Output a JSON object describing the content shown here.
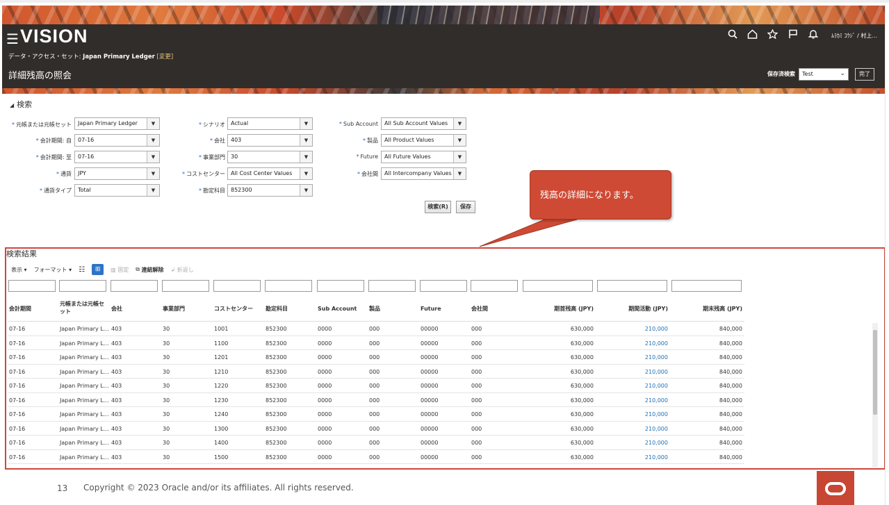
{
  "header": {
    "logo": "VISION",
    "data_access_label": "データ・アクセス・セット: ",
    "data_access_value": "Japan Primary Ledger",
    "data_access_link": "[変更]",
    "page_title": "詳細残高の照会",
    "user": "ﾑﾗｶﾐ ｺｳｼﾞ / 村上…",
    "saved_search_label": "保存済検索",
    "saved_search_value": "Test",
    "done_button": "完了",
    "icons": [
      "search-icon",
      "home-icon",
      "star-icon",
      "flag-icon",
      "bell-icon"
    ]
  },
  "search": {
    "title": "検索",
    "fields": [
      {
        "label": "元帳または元帳セット",
        "value": "Japan Primary Ledger"
      },
      {
        "label": "会計期間: 自",
        "value": "07-16"
      },
      {
        "label": "会計期間: 至",
        "value": "07-16"
      },
      {
        "label": "通貨",
        "value": "JPY"
      },
      {
        "label": "通貨タイプ",
        "value": "Total"
      },
      {
        "label": "シナリオ",
        "value": "Actual"
      },
      {
        "label": "会社",
        "value": "403"
      },
      {
        "label": "事業部門",
        "value": "30"
      },
      {
        "label": "コストセンター",
        "value": "All Cost Center Values"
      },
      {
        "label": "勘定科目",
        "value": "852300"
      },
      {
        "label": "Sub Account",
        "value": "All Sub Account Values"
      },
      {
        "label": "製品",
        "value": "All Product Values"
      },
      {
        "label": "Future",
        "value": "All Future Values"
      },
      {
        "label": "会社間",
        "value": "All Intercompany Values"
      }
    ],
    "search_button": "検索(R)",
    "save_button": "保存"
  },
  "callout": "残高の詳細になります。",
  "results": {
    "title": "検索結果",
    "toolbar": {
      "view": "表示",
      "format": "フォーマット",
      "freeze": "固定",
      "detach": "連結解除",
      "wrap": "折返し"
    },
    "columns": [
      "会計期間",
      "元帳または元帳セット",
      "会社",
      "事業部門",
      "コストセンター",
      "勘定科目",
      "Sub Account",
      "製品",
      "Future",
      "会社間",
      "期首残高 (JPY)",
      "期間活動 (JPY)",
      "期末残高 (JPY)"
    ],
    "rows": [
      [
        "07-16",
        "Japan Primary L…",
        "403",
        "30",
        "1001",
        "852300",
        "0000",
        "000",
        "00000",
        "000",
        "630,000",
        "210,000",
        "840,000"
      ],
      [
        "07-16",
        "Japan Primary L…",
        "403",
        "30",
        "1100",
        "852300",
        "0000",
        "000",
        "00000",
        "000",
        "630,000",
        "210,000",
        "840,000"
      ],
      [
        "07-16",
        "Japan Primary L…",
        "403",
        "30",
        "1201",
        "852300",
        "0000",
        "000",
        "00000",
        "000",
        "630,000",
        "210,000",
        "840,000"
      ],
      [
        "07-16",
        "Japan Primary L…",
        "403",
        "30",
        "1210",
        "852300",
        "0000",
        "000",
        "00000",
        "000",
        "630,000",
        "210,000",
        "840,000"
      ],
      [
        "07-16",
        "Japan Primary L…",
        "403",
        "30",
        "1220",
        "852300",
        "0000",
        "000",
        "00000",
        "000",
        "630,000",
        "210,000",
        "840,000"
      ],
      [
        "07-16",
        "Japan Primary L…",
        "403",
        "30",
        "1230",
        "852300",
        "0000",
        "000",
        "00000",
        "000",
        "630,000",
        "210,000",
        "840,000"
      ],
      [
        "07-16",
        "Japan Primary L…",
        "403",
        "30",
        "1240",
        "852300",
        "0000",
        "000",
        "00000",
        "000",
        "630,000",
        "210,000",
        "840,000"
      ],
      [
        "07-16",
        "Japan Primary L…",
        "403",
        "30",
        "1300",
        "852300",
        "0000",
        "000",
        "00000",
        "000",
        "630,000",
        "210,000",
        "840,000"
      ],
      [
        "07-16",
        "Japan Primary L…",
        "403",
        "30",
        "1400",
        "852300",
        "0000",
        "000",
        "00000",
        "000",
        "630,000",
        "210,000",
        "840,000"
      ],
      [
        "07-16",
        "Japan Primary L…",
        "403",
        "30",
        "1500",
        "852300",
        "0000",
        "000",
        "00000",
        "000",
        "630,000",
        "210,000",
        "840,000"
      ]
    ]
  },
  "footer": {
    "page_number": "13",
    "copyright": "Copyright © 2023 Oracle and/or its affiliates. All rights reserved."
  },
  "colors": {
    "header_bg": "#312d2a",
    "callout": "#cf4a34",
    "highlight_border": "#d0463a",
    "link": "#1f6fb3",
    "oracle_red": "#c74634"
  }
}
